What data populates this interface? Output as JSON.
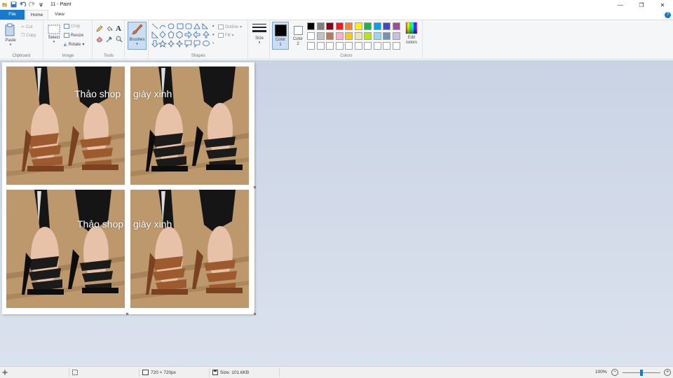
{
  "window": {
    "title": "11 - Paint",
    "minimize": "—",
    "restore": "❐",
    "close": "✕"
  },
  "tabs": {
    "file": "File",
    "home": "Home",
    "view": "View"
  },
  "help": "?",
  "ribbon": {
    "clipboard": {
      "label": "Clipboard",
      "paste": "Paste",
      "cut": "Cut",
      "copy": "Copy"
    },
    "image": {
      "label": "Image",
      "select": "Select",
      "crop": "Crop",
      "resize": "Resize",
      "rotate": "Rotate"
    },
    "tools": {
      "label": "Tools",
      "text_glyph": "A"
    },
    "brushes": {
      "label": "Brushes"
    },
    "shapes": {
      "label": "Shapes",
      "outline": "Outline",
      "fill": "Fill"
    },
    "size": {
      "label": "Size"
    },
    "colors": {
      "label": "Colors",
      "color1": "Color\n1",
      "color2": "Color\n2",
      "edit": "Edit\ncolors",
      "color1_value": "#000000",
      "color2_value": "#ffffff",
      "palette_row1": [
        "#000000",
        "#7f7f7f",
        "#880015",
        "#ed1c24",
        "#ff7f27",
        "#fff200",
        "#22b14c",
        "#00a2e8",
        "#3f48cc",
        "#a349a4"
      ],
      "palette_row2": [
        "#ffffff",
        "#c3c3c3",
        "#b97a57",
        "#ffaec9",
        "#ffc90e",
        "#efe4b0",
        "#b5e61d",
        "#99d9ea",
        "#7092be",
        "#c8bfe7"
      ],
      "palette_row3": [
        "#ffffff",
        "#ffffff",
        "#ffffff",
        "#ffffff",
        "#ffffff",
        "#ffffff",
        "#ffffff",
        "#ffffff",
        "#ffffff",
        "#ffffff"
      ]
    }
  },
  "canvas": {
    "photos": [
      {
        "sandal": "tan",
        "overlay": "Thảo shop"
      },
      {
        "sandal": "black",
        "overlay": "giày xinh"
      },
      {
        "sandal": "black",
        "overlay": "Thảo shop"
      },
      {
        "sandal": "tan",
        "overlay": "giày xinh"
      }
    ]
  },
  "statusbar": {
    "dimensions": "720 × 720px",
    "size": "Size: 101.6KB",
    "zoom": "100%",
    "zoom_minus": "−",
    "zoom_plus": "+",
    "zoom_level": 1.0
  }
}
